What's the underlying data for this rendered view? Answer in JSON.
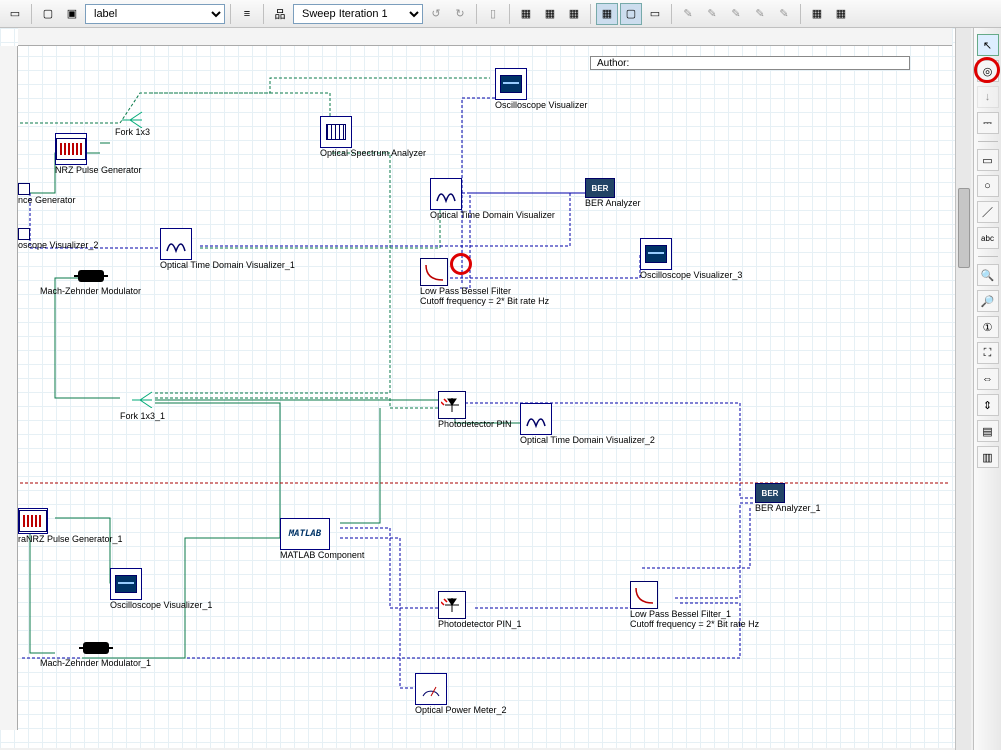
{
  "toolbar": {
    "label_combo": "label",
    "sweep_combo": "Sweep Iteration 1"
  },
  "author_label": "Author:",
  "right_tools": [
    "pointer",
    "target",
    "down",
    "wires",
    "rect",
    "circ",
    "line",
    "text",
    "sep",
    "zoomin",
    "zoomout",
    "zoom1",
    "zoomfit",
    "hlocks",
    "vlocks",
    "align1",
    "align2"
  ],
  "blocks": {
    "nrz1": {
      "label": "NRZ Pulse Generator"
    },
    "fork1": {
      "label": "Fork 1x3"
    },
    "nceGen": {
      "label": "nce Generator"
    },
    "scopeVis2": {
      "label": "oscope Visualizer_2"
    },
    "mzm1": {
      "label": "Mach-Zehnder Modulator"
    },
    "otdv1": {
      "label": "Optical Time Domain Visualizer_1"
    },
    "osa": {
      "label": "Optical Spectrum Analyzer"
    },
    "scopeVis": {
      "label": "Oscilloscope Visualizer"
    },
    "otdv": {
      "label": "Optical Time Domain Visualizer"
    },
    "ber": {
      "label": "BER Analyzer"
    },
    "scopeVis3": {
      "label": "Oscilloscope Visualizer_3"
    },
    "lpbf": {
      "label": "Low Pass Bessel Filter",
      "sub": "Cutoff frequency = 2* Bit rate  Hz"
    },
    "fork2": {
      "label": "Fork 1x3_1"
    },
    "pdPin": {
      "label": "Photodetector PIN"
    },
    "otdv2": {
      "label": "Optical Time Domain Visualizer_2"
    },
    "matlab": {
      "label": "MATLAB Component"
    },
    "nrz2": {
      "label": "raNRZ Pulse Generator_1"
    },
    "scopeVis_1": {
      "label": "Oscilloscope Visualizer_1"
    },
    "pdPin1": {
      "label": "Photodetector PIN_1"
    },
    "ber1": {
      "label": "BER Analyzer_1"
    },
    "lpbf1": {
      "label": "Low Pass Bessel Filter_1",
      "sub": "Cutoff frequency = 2* Bit rate  Hz"
    },
    "mzm2": {
      "label": "Mach-Zehnder Modulator_1"
    },
    "opm2": {
      "label": "Optical Power Meter_2"
    }
  }
}
